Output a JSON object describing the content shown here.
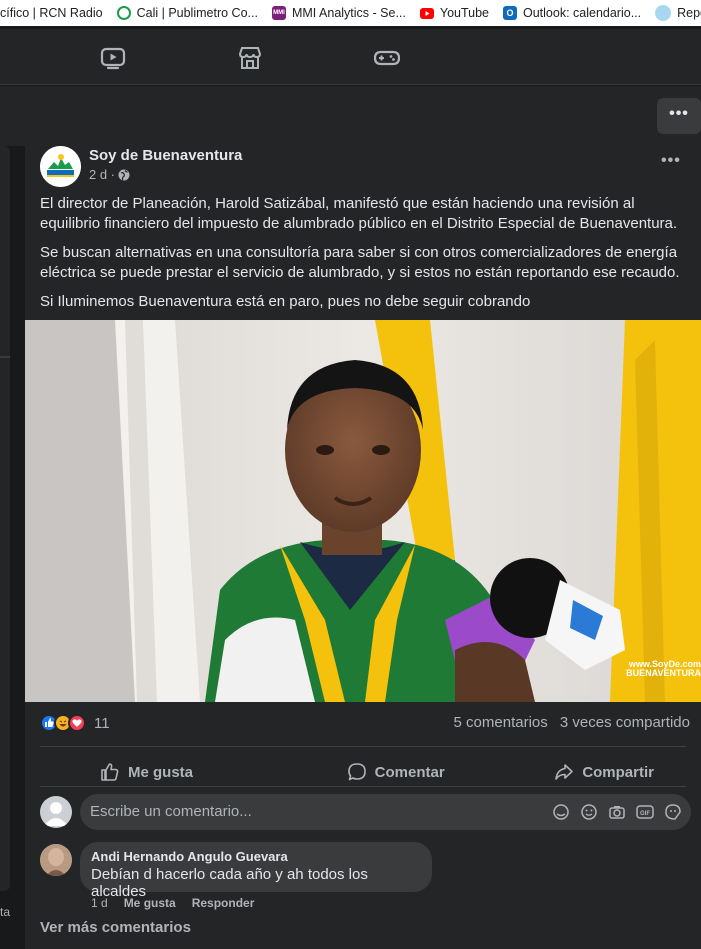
{
  "bookmarks": [
    {
      "label": "cífico | RCN Radio",
      "icon": "rcn-favicon",
      "color": "#ffffff"
    },
    {
      "label": "Cali | Publimetro Co...",
      "icon": "globe-icon",
      "color": "#1a9c4b"
    },
    {
      "label": "MMI Analytics - Se...",
      "icon": "mmi-favicon",
      "color": "#7b1f7a"
    },
    {
      "label": "YouTube",
      "icon": "youtube-icon",
      "color": "#ff0000"
    },
    {
      "label": "Outlook: calendario...",
      "icon": "outlook-icon",
      "color": "#0f6cbd"
    },
    {
      "label": "Repo",
      "icon": "circle-favicon",
      "color": "#a7d8f0"
    }
  ],
  "nav": {
    "icons": [
      "video-icon",
      "marketplace-icon",
      "gaming-icon"
    ],
    "more_label": "•••"
  },
  "post": {
    "page_name": "Soy de Buenaventura",
    "time": "2 d ·",
    "audience_icon": "globe-icon",
    "menu_label": "•••",
    "paragraphs": [
      "El director de Planeación, Harold Satizábal, manifestó que están haciendo una revisión al equilibrio financiero del impuesto de alumbrado público en el Distrito Especial de Buenaventura.",
      "Se buscan alternativas en una consultoría para saber si con otros comercializadores de energía eléctrica se puede prestar el servicio de alumbrado, y si estos no están reportando ese recaudo.",
      "Si Iluminemos Buenaventura está en paro, pues no debe seguir cobrando"
    ],
    "watermark": "www.SoyDe.com BUENAVENTURA",
    "reactions": {
      "types": [
        "like-icon",
        "haha-icon",
        "love-icon"
      ],
      "count": "11"
    },
    "comments_count": "5 comentarios",
    "shares_count": "3 veces compartido",
    "actions": {
      "like": "Me gusta",
      "comment": "Comentar",
      "share": "Compartir"
    },
    "comment_placeholder": "Escribe un comentario...",
    "comment": {
      "author": "Andi Hernando Angulo Guevara",
      "text": "Debían d hacerlo cada año y ah todos los alcaldes",
      "time": "1 d",
      "like": "Me gusta",
      "reply": "Responder"
    },
    "more_comments": "Ver más comentarios"
  },
  "left_fragment": "ta",
  "colors": {
    "background": "#18191a",
    "card": "#242526",
    "text": "#e4e6eb",
    "secondary": "#b0b3b8",
    "like_blue": "#1877f2",
    "love_red": "#f33e58",
    "haha_yellow": "#f7b125"
  }
}
